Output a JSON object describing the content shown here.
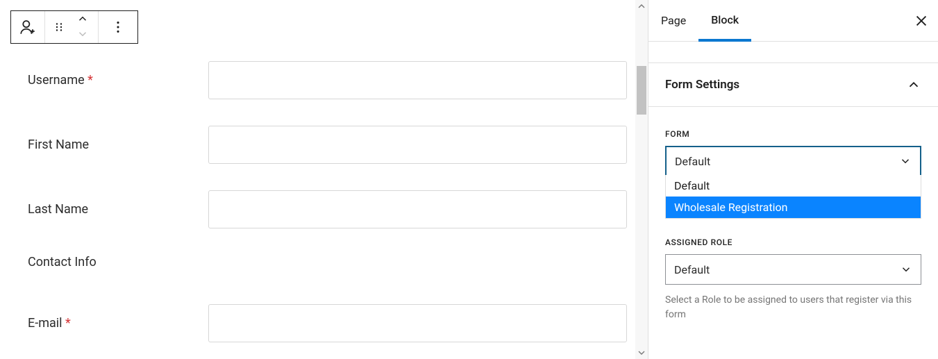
{
  "form": {
    "fields": {
      "username": {
        "label": "Username",
        "required_mark": "*",
        "value": ""
      },
      "first_name": {
        "label": "First Name",
        "value": ""
      },
      "last_name": {
        "label": "Last Name",
        "value": ""
      },
      "email": {
        "label": "E-mail",
        "required_mark": "*",
        "value": ""
      }
    },
    "sections": {
      "contact": {
        "label": "Contact Info"
      }
    }
  },
  "sidebar": {
    "tabs": {
      "page": "Page",
      "block": "Block"
    },
    "panel": {
      "title": "Form Settings"
    },
    "controls": {
      "form": {
        "label": "FORM",
        "selected": "Default",
        "options": {
          "0": "Default",
          "1": "Wholesale Registration"
        }
      },
      "role": {
        "label": "ASSIGNED ROLE",
        "selected": "Default",
        "help": "Select a Role to be assigned to users that register via this form"
      }
    }
  }
}
